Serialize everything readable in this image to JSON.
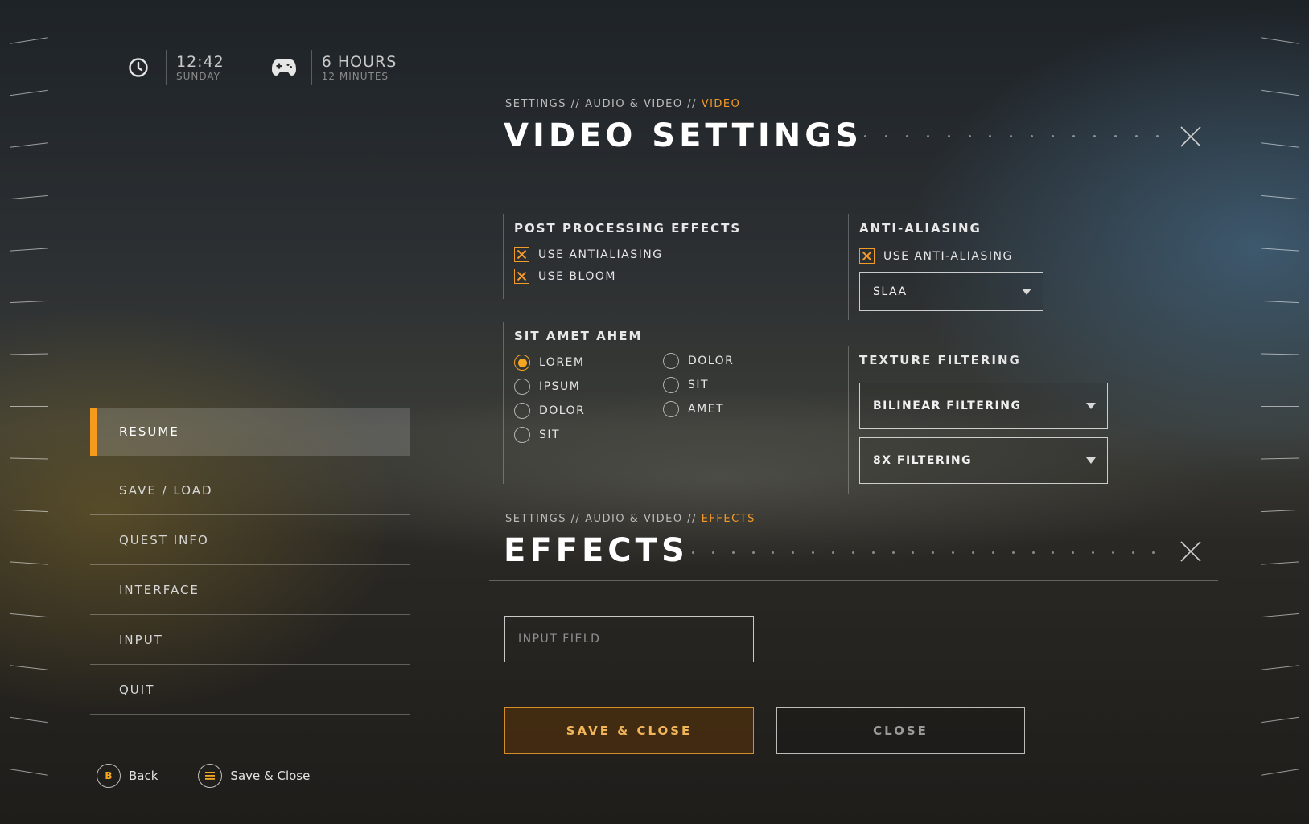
{
  "status": {
    "time": "12:42",
    "day": "SUNDAY",
    "playtime_hours": "6 HOURS",
    "playtime_minutes": "12 MINUTES",
    "clock_icon": "clock-icon",
    "controller_icon": "gamepad-icon"
  },
  "menu": {
    "items": [
      {
        "label": "RESUME"
      },
      {
        "label": "SAVE / LOAD"
      },
      {
        "label": "QUEST INFO"
      },
      {
        "label": "INTERFACE"
      },
      {
        "label": "INPUT"
      },
      {
        "label": "QUIT"
      }
    ],
    "active_color": "#f59a1c"
  },
  "hints": {
    "back_key": "B",
    "back_label": "Back",
    "save_key_icon": "menu-lines-icon",
    "save_label": "Save & Close"
  },
  "video": {
    "crumb_1": "SETTINGS",
    "crumb_2": "AUDIO & VIDEO",
    "crumb_current": "VIDEO",
    "title": "VIDEO SETTINGS",
    "post_processing": {
      "title": "POST PROCESSING EFFECTS",
      "options": [
        {
          "label": "USE ANTIALIASING",
          "checked": true
        },
        {
          "label": "USE BLOOM",
          "checked": true
        }
      ]
    },
    "radio_group": {
      "title": "SIT AMET AHEM",
      "col1": [
        {
          "label": "LOREM",
          "selected": true
        },
        {
          "label": "IPSUM",
          "selected": false
        },
        {
          "label": "DOLOR",
          "selected": false
        },
        {
          "label": "SIT",
          "selected": false
        }
      ],
      "col2": [
        {
          "label": "DOLOR",
          "selected": false
        },
        {
          "label": "SIT",
          "selected": false
        },
        {
          "label": "AMET",
          "selected": false
        }
      ]
    },
    "anti_aliasing": {
      "title": "ANTI-ALIASING",
      "checkbox_label": "USE ANTI-ALIASING",
      "checked": true,
      "mode": "SLAA"
    },
    "texture_filtering": {
      "title": "TEXTURE FILTERING",
      "filter": "BILINEAR FILTERING",
      "level": "8X FILTERING"
    }
  },
  "effects": {
    "crumb_1": "SETTINGS",
    "crumb_2": "AUDIO & VIDEO",
    "crumb_current": "EFFECTS",
    "title": "EFFECTS",
    "input_placeholder": "INPUT FIELD",
    "save_button": "SAVE & CLOSE",
    "close_button": "CLOSE"
  },
  "colors": {
    "accent": "#f29a2a",
    "text": "#e6e6e6"
  }
}
